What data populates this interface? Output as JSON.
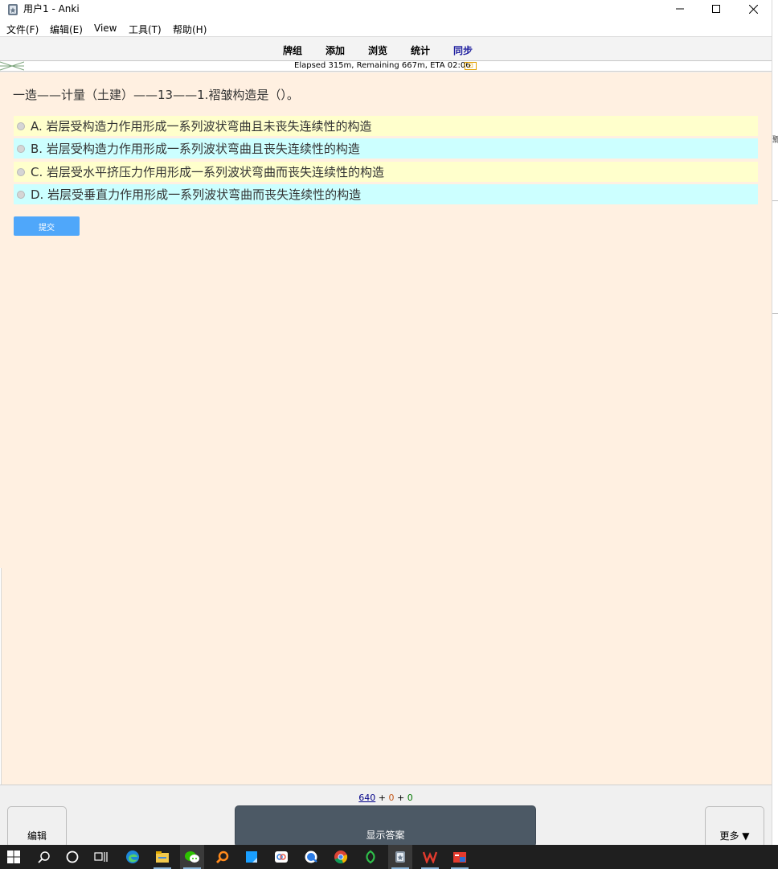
{
  "window": {
    "title": "用户1 - Anki"
  },
  "menu": {
    "file": "文件(F)",
    "edit": "编辑(E)",
    "view": "View",
    "tools": "工具(T)",
    "help": "帮助(H)"
  },
  "toolbar": {
    "decks": "牌组",
    "add": "添加",
    "browse": "浏览",
    "stats": "统计",
    "sync": "同步"
  },
  "progress": {
    "text": "Elapsed 315m, Remaining 667m, ETA 02:06"
  },
  "card": {
    "question": "一造——计量（土建）——13——1.褶皱构造是（）。",
    "options": [
      {
        "label": "A. 岩层受构造力作用形成一系列波状弯曲且未丧失连续性的构造",
        "color": "#ffffcc"
      },
      {
        "label": "B. 岩层受构造力作用形成一系列波状弯曲且丧失连续性的构造",
        "color": "#ccffff"
      },
      {
        "label": "C. 岩层受水平挤压力作用形成一系列波状弯曲而丧失连续性的构造",
        "color": "#ffffcc"
      },
      {
        "label": "D. 岩层受垂直力作用形成一系列波状弯曲而丧失连续性的构造",
        "color": "#ccffff"
      }
    ],
    "submit_label": "提交",
    "background": "#fff0e1"
  },
  "bottom": {
    "count_new": "640",
    "count_learn": "0",
    "count_review": "0",
    "plus": "+",
    "edit_label": "编辑",
    "show_answer_label": "显示答案",
    "more_label": "更多 ▼"
  },
  "taskbar": {
    "icons": [
      "windows-start",
      "search",
      "cortana",
      "task-view",
      "edge",
      "file-explorer",
      "wechat",
      "search-everything",
      "notes",
      "baidu-netdisk",
      "qq-browser",
      "chrome",
      "green-app",
      "anki",
      "wps-office",
      "red-app"
    ]
  },
  "right_edge": {
    "glyph": "鄹"
  }
}
